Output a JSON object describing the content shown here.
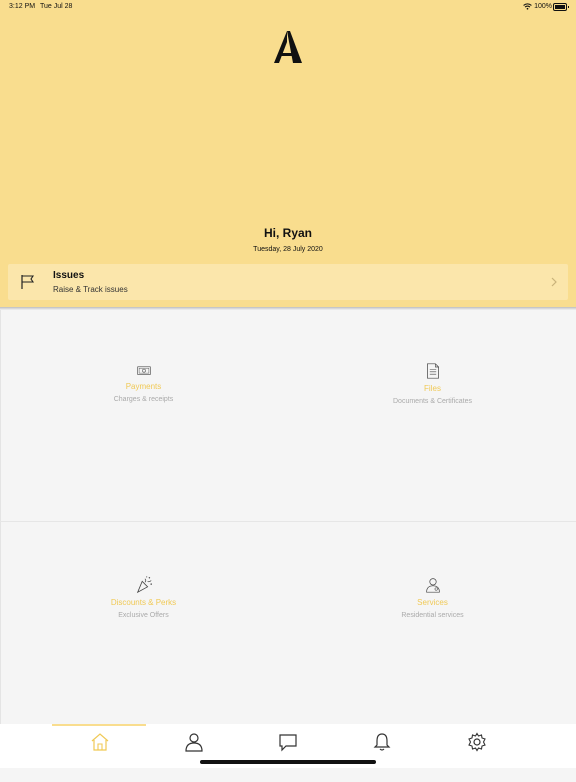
{
  "status_bar": {
    "time": "3:12 PM",
    "date": "Tue Jul 28",
    "battery": "100%"
  },
  "greeting": "Hi, Ryan",
  "today": "Tuesday, 28 July 2020",
  "issues_card": {
    "title": "Issues",
    "subtitle": "Raise & Track issues"
  },
  "tiles": [
    {
      "title": "Payments",
      "subtitle": "Charges & receipts",
      "icon": "cash-icon"
    },
    {
      "title": "Files",
      "subtitle": "Documents & Certificates",
      "icon": "document-icon"
    },
    {
      "title": "Discounts & Perks",
      "subtitle": "Exclusive Offers",
      "icon": "confetti-icon"
    },
    {
      "title": "Services",
      "subtitle": "Residential services",
      "icon": "person-icon"
    }
  ],
  "tabbar": {
    "active_tab": "home",
    "tabs": [
      "home",
      "profile",
      "messages",
      "notifications",
      "settings"
    ]
  },
  "colors": {
    "brand_yellow": "#f9dd8e",
    "card_yellow": "#fbe6ab",
    "accent_text": "#f0c955"
  }
}
